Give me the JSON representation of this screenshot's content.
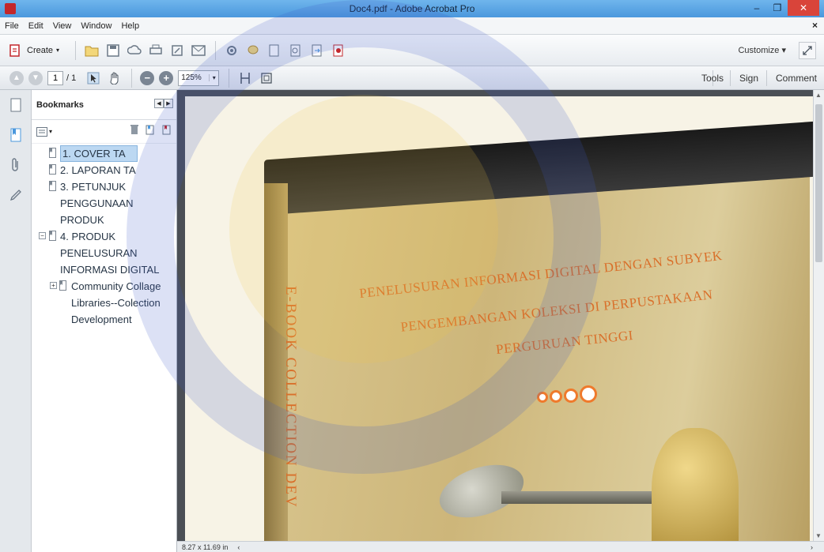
{
  "window": {
    "title": "Doc4.pdf - Adobe Acrobat Pro"
  },
  "menu": [
    "File",
    "Edit",
    "View",
    "Window",
    "Help"
  ],
  "toolbar": {
    "create_label": "Create",
    "customize_label": "Customize"
  },
  "nav": {
    "page_current": "1",
    "page_total": "/ 1",
    "zoom": "125%"
  },
  "tabs": {
    "tools": "Tools",
    "sign": "Sign",
    "comment": "Comment"
  },
  "bookmarks": {
    "title": "Bookmarks",
    "items": [
      {
        "label": "1. COVER TA"
      },
      {
        "label": "2. LAPORAN TA"
      },
      {
        "label": "3. PETUNJUK PENGGUNAAN PRODUK"
      },
      {
        "label": "4. PRODUK PENELUSURAN INFORMASI DIGITAL"
      },
      {
        "label": "Community Collage Libraries--Colection Development"
      }
    ]
  },
  "document": {
    "line1": "PENELUSURAN INFORMASI DIGITAL DENGAN SUBYEK",
    "line2": "PENGEMBANGAN KOLEKSI DI PERPUSTAKAAN",
    "line3": "PERGURUAN TINGGI",
    "spine": "E-BOOK COLLECTION DEV"
  },
  "status": {
    "page_size": "8.27 x 11.69 in"
  },
  "colors": {
    "accent": "#4b98dd",
    "cover_text": "#d9702b",
    "selection": "#bcd8f2"
  }
}
